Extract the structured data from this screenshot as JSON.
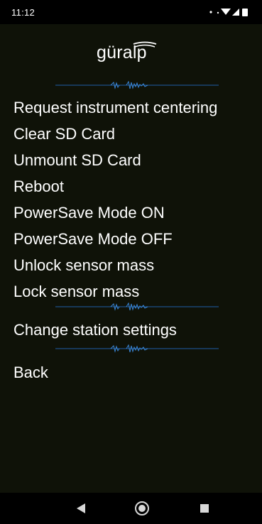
{
  "status_bar": {
    "time": "11:12",
    "icons": [
      "dot-icon",
      "wifi-icon",
      "signal-icon",
      "battery-icon"
    ]
  },
  "app": {
    "logo_text": "güralp"
  },
  "menu": {
    "items": [
      "Request instrument centering",
      "Clear SD Card",
      "Unmount SD Card",
      "Reboot",
      "PowerSave Mode ON",
      "PowerSave Mode OFF",
      "Unlock sensor mass",
      "Lock sensor mass"
    ],
    "settings": "Change station settings",
    "back": "Back"
  },
  "nav_bar": {
    "buttons": [
      "back-triangle-icon",
      "home-circle-icon",
      "recents-square-icon"
    ]
  },
  "colors": {
    "background": "#0f1208",
    "text": "#ffffff",
    "divider": "#1f5fa8"
  }
}
